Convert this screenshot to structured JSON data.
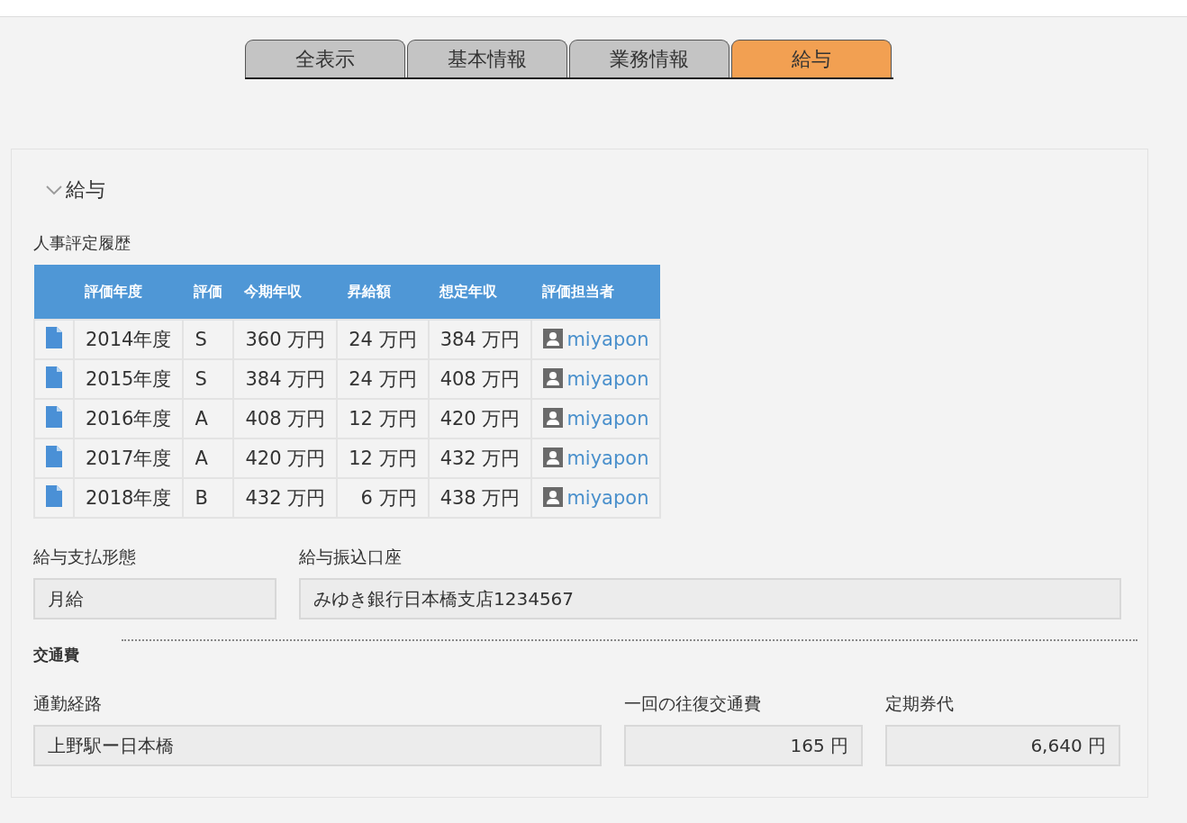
{
  "tabs": [
    {
      "label": "全表示",
      "selected": false
    },
    {
      "label": "基本情報",
      "selected": false
    },
    {
      "label": "業務情報",
      "selected": false
    },
    {
      "label": "給与",
      "selected": true
    }
  ],
  "section": {
    "title": "給与",
    "expanded": true
  },
  "history": {
    "title": "人事評定履歴",
    "columns": [
      "評価年度",
      "評価",
      "今期年収",
      "昇給額",
      "想定年収",
      "評価担当者"
    ],
    "rows": [
      {
        "cells": [
          "2014年度",
          "S",
          "360 万円",
          "24 万円",
          "384 万円"
        ],
        "evaluator": "miyapon"
      },
      {
        "cells": [
          "2015年度",
          "S",
          "384 万円",
          "24 万円",
          "408 万円"
        ],
        "evaluator": "miyapon"
      },
      {
        "cells": [
          "2016年度",
          "A",
          "408 万円",
          "12 万円",
          "420 万円"
        ],
        "evaluator": "miyapon"
      },
      {
        "cells": [
          "2017年度",
          "A",
          "420 万円",
          "12 万円",
          "432 万円"
        ],
        "evaluator": "miyapon"
      },
      {
        "cells": [
          "2018年度",
          "B",
          "432 万円",
          "6 万円",
          "438 万円"
        ],
        "evaluator": "miyapon"
      }
    ]
  },
  "salary_fields": [
    {
      "label": "給与支払形態",
      "value": "月給"
    },
    {
      "label": "給与振込口座",
      "value": "みゆき銀行日本橋支店1234567"
    }
  ],
  "transport": {
    "title": "交通費",
    "fields": [
      {
        "label": "通勤経路",
        "value": "上野駅ー日本橋",
        "kind": "text"
      },
      {
        "label": "一回の往復交通費",
        "value": "165 円",
        "kind": "amount"
      },
      {
        "label": "定期券代",
        "value": "6,640 円",
        "kind": "amount"
      }
    ]
  }
}
